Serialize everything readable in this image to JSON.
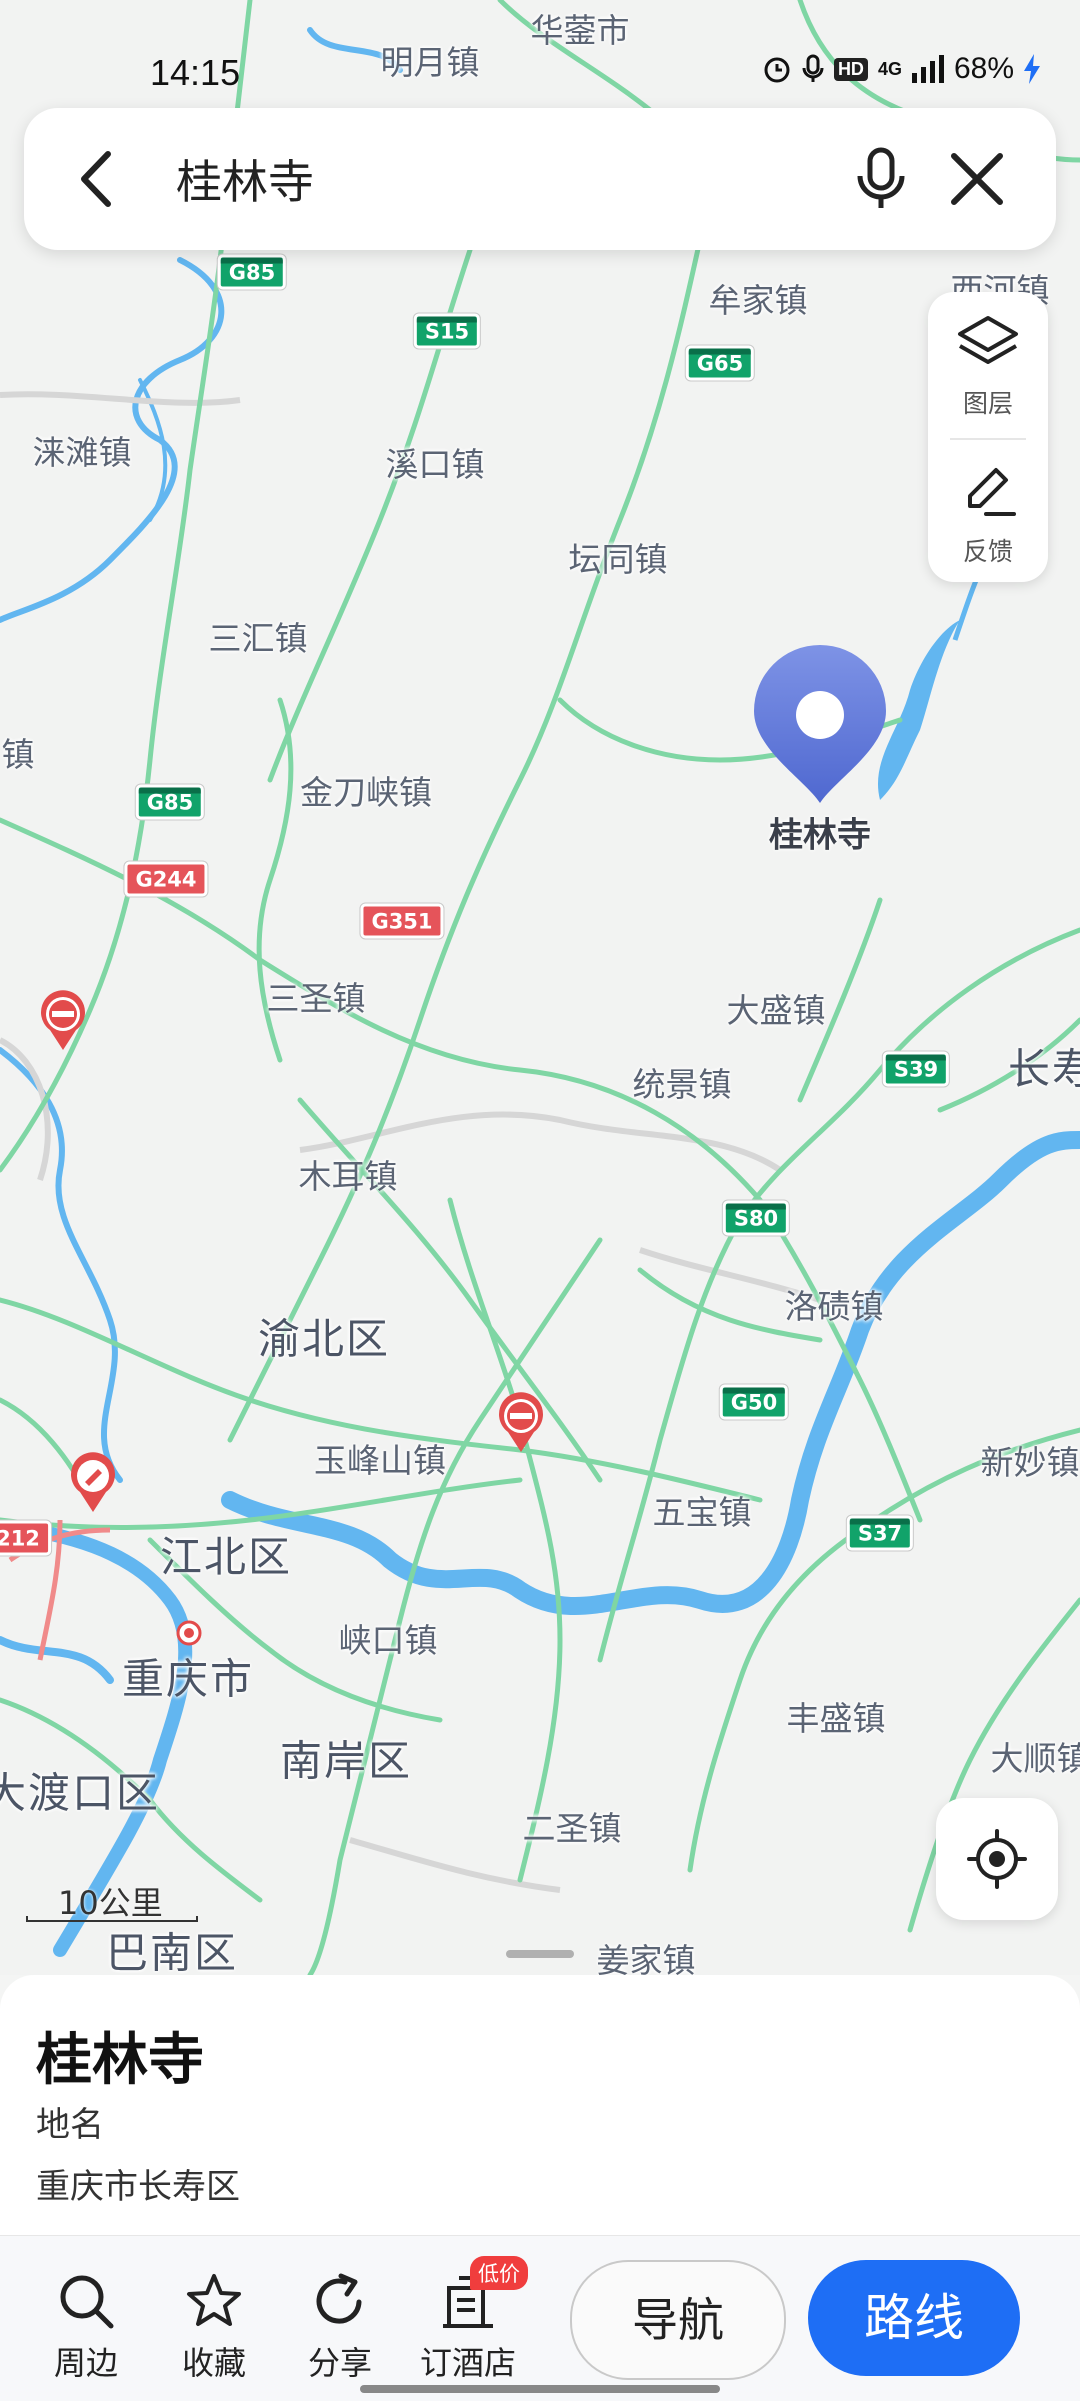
{
  "status_bar": {
    "time": "14:15",
    "network": "4G",
    "battery": "68%"
  },
  "search": {
    "query": "桂林寺"
  },
  "side_panel": {
    "layers_label": "图层",
    "feedback_label": "反馈"
  },
  "map": {
    "pin_label": "桂林寺",
    "scale_label": "10公里",
    "place_labels": [
      "华蓥市",
      "明月镇",
      "牟家镇",
      "西河镇",
      "涞滩镇",
      "溪口镇",
      "坛同镇",
      "三汇镇",
      "金刀峡镇",
      "三圣镇",
      "大盛镇",
      "统景镇",
      "长寿",
      "木耳镇",
      "洛碛镇",
      "渝北区",
      "玉峰山镇",
      "新妙镇",
      "五宝镇",
      "江北区",
      "峡口镇",
      "重庆市",
      "丰盛镇",
      "南岸区",
      "大顺镇",
      "大渡口区",
      "二圣镇",
      "巴南区",
      "姜家镇",
      "镇"
    ],
    "road_shields": [
      "G85",
      "S15",
      "G65",
      "G85",
      "G244",
      "G351",
      "S39",
      "S80",
      "G50",
      "S37",
      "212"
    ],
    "colors": {
      "road": "#7fd6a4",
      "water": "#62b6f0",
      "pin": "#5a73d6",
      "national_highway": "#e5545a",
      "expressway": "#11a36a"
    }
  },
  "place": {
    "name": "桂林寺",
    "type": "地名",
    "address": "重庆市长寿区"
  },
  "toolbar": {
    "nearby": "周边",
    "favorite": "收藏",
    "share": "分享",
    "hotel": "订酒店",
    "hotel_badge": "低价",
    "navigate": "导航",
    "route": "路线",
    "accent": "#1e6ef5"
  }
}
